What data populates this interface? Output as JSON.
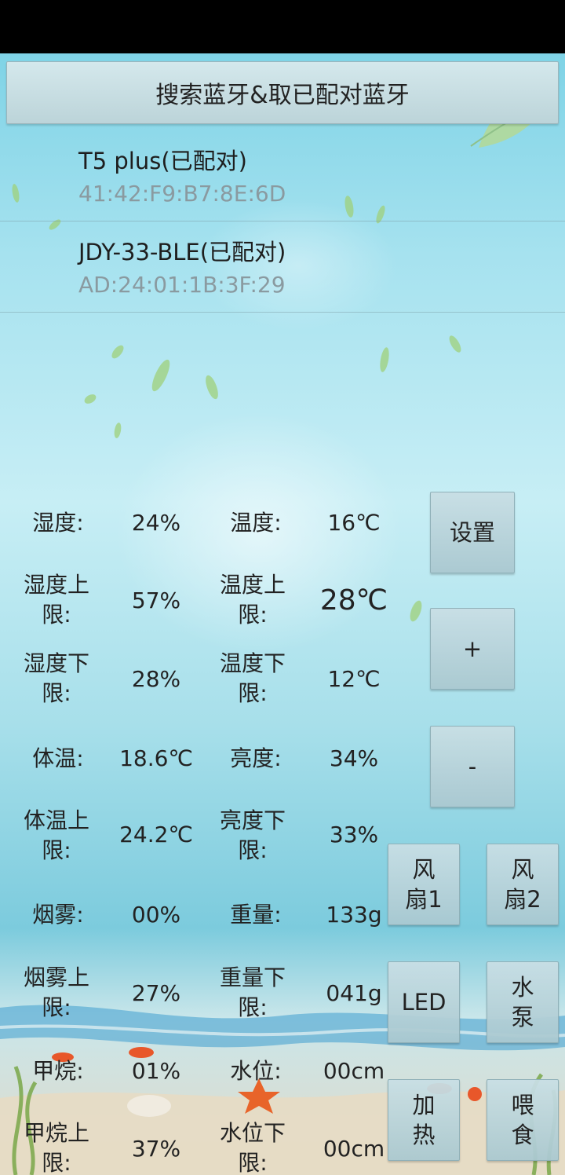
{
  "header": {
    "search_button": "搜索蓝牙&取已配对蓝牙"
  },
  "devices": [
    {
      "name": "T5 plus(已配对)",
      "mac": "41:42:F9:B7:8E:6D"
    },
    {
      "name": "JDY-33-BLE(已配对)",
      "mac": "AD:24:01:1B:3F:29"
    }
  ],
  "readings": {
    "humidity_label": "湿度:",
    "humidity": "24%",
    "temp_label": "温度:",
    "temp": "16℃",
    "humidity_upper_label": "湿度上\n限:",
    "humidity_upper": "57%",
    "temp_upper_label": "温度上\n限:",
    "temp_upper": "28℃",
    "humidity_lower_label": "湿度下\n限:",
    "humidity_lower": "28%",
    "temp_lower_label": "温度下\n限:",
    "temp_lower": "12℃",
    "body_temp_label": "体温:",
    "body_temp": "18.6℃",
    "brightness_label": "亮度:",
    "brightness": "34%",
    "body_temp_upper_label": "体温上\n限:",
    "body_temp_upper": "24.2℃",
    "brightness_lower_label": "亮度下\n限:",
    "brightness_lower": "33%",
    "smoke_label": "烟雾:",
    "smoke": "00%",
    "weight_label": "重量:",
    "weight": "133g",
    "smoke_upper_label": "烟雾上\n限:",
    "smoke_upper": "27%",
    "weight_lower_label": "重量下\n限:",
    "weight_lower": "041g",
    "methane_label": "甲烷:",
    "methane": "01%",
    "water_level_label": "水位:",
    "water_level": "00cm",
    "methane_upper_label": "甲烷上\n限:",
    "methane_upper": "37%",
    "water_level_lower_label": "水位下\n限:",
    "water_level_lower": "00cm"
  },
  "buttons": {
    "settings": "设置",
    "plus": "+",
    "minus": "-",
    "fan1": "风\n扇1",
    "fan2": "风\n扇2",
    "led": "LED",
    "pump": "水\n泵",
    "heat": "加\n热",
    "feed": "喂\n食"
  },
  "colors": {
    "button_bg": "#bcd4d9",
    "mac_text": "#8a9aa0"
  }
}
